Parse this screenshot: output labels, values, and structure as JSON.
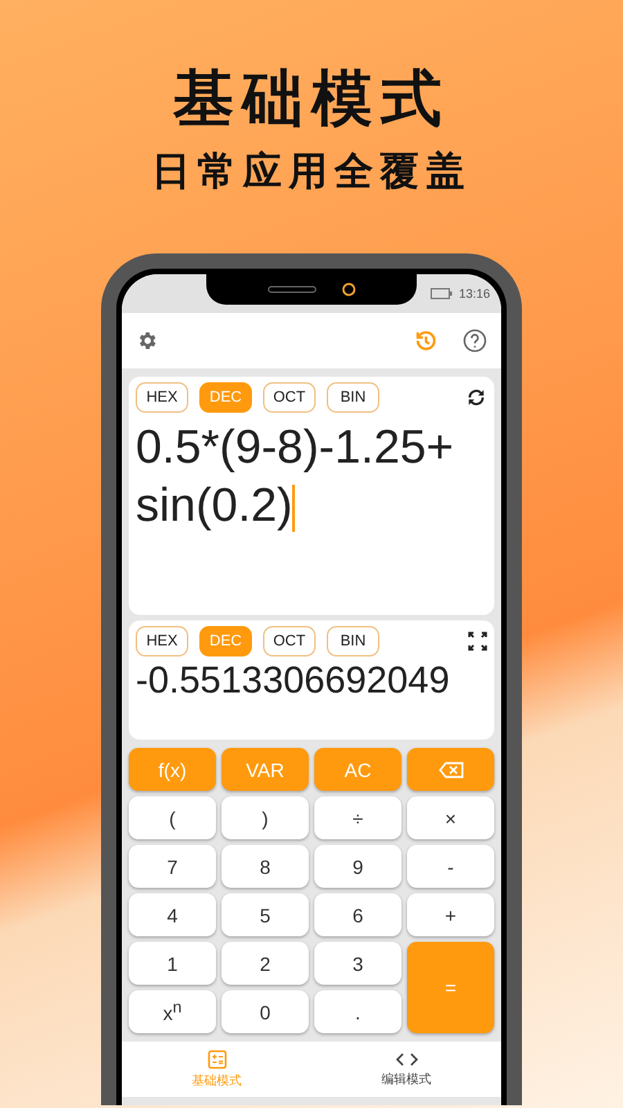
{
  "headline": "基础模式",
  "subheadline": "日常应用全覆盖",
  "status_bar": {
    "time": "13:16"
  },
  "input_panel": {
    "bases": [
      {
        "label": "HEX",
        "selected": false
      },
      {
        "label": "DEC",
        "selected": true
      },
      {
        "label": "OCT",
        "selected": false
      },
      {
        "label": "BIN",
        "selected": false
      }
    ],
    "expression": "0.5*(9-8)-1.25+sin(0.2)"
  },
  "result_panel": {
    "bases": [
      {
        "label": "HEX",
        "selected": false
      },
      {
        "label": "DEC",
        "selected": true
      },
      {
        "label": "OCT",
        "selected": false
      },
      {
        "label": "BIN",
        "selected": false
      }
    ],
    "result": "-0.5513306692049"
  },
  "keys": [
    {
      "kind": "accent",
      "label": "f(x)"
    },
    {
      "kind": "accent",
      "label": "VAR"
    },
    {
      "kind": "accent",
      "label": "AC"
    },
    {
      "kind": "backspace"
    },
    {
      "kind": "plain",
      "label": "("
    },
    {
      "kind": "plain",
      "label": ")"
    },
    {
      "kind": "plain",
      "label": "÷"
    },
    {
      "kind": "plain",
      "label": "×"
    },
    {
      "kind": "plain",
      "label": "7"
    },
    {
      "kind": "plain",
      "label": "8"
    },
    {
      "kind": "plain",
      "label": "9"
    },
    {
      "kind": "plain",
      "label": "-"
    },
    {
      "kind": "plain",
      "label": "4"
    },
    {
      "kind": "plain",
      "label": "5"
    },
    {
      "kind": "plain",
      "label": "6"
    },
    {
      "kind": "plain",
      "label": "+"
    },
    {
      "kind": "plain",
      "label": "1"
    },
    {
      "kind": "plain",
      "label": "2"
    },
    {
      "kind": "plain",
      "label": "3"
    },
    {
      "kind": "equals",
      "label": "="
    },
    {
      "kind": "plain",
      "label": "x$^{n}$"
    },
    {
      "kind": "plain",
      "label": "0"
    },
    {
      "kind": "plain",
      "label": "."
    }
  ],
  "bottom_nav": [
    {
      "label": "基础模式",
      "selected": true,
      "kind": "grid"
    },
    {
      "label": "编辑模式",
      "selected": false,
      "kind": "code"
    }
  ]
}
